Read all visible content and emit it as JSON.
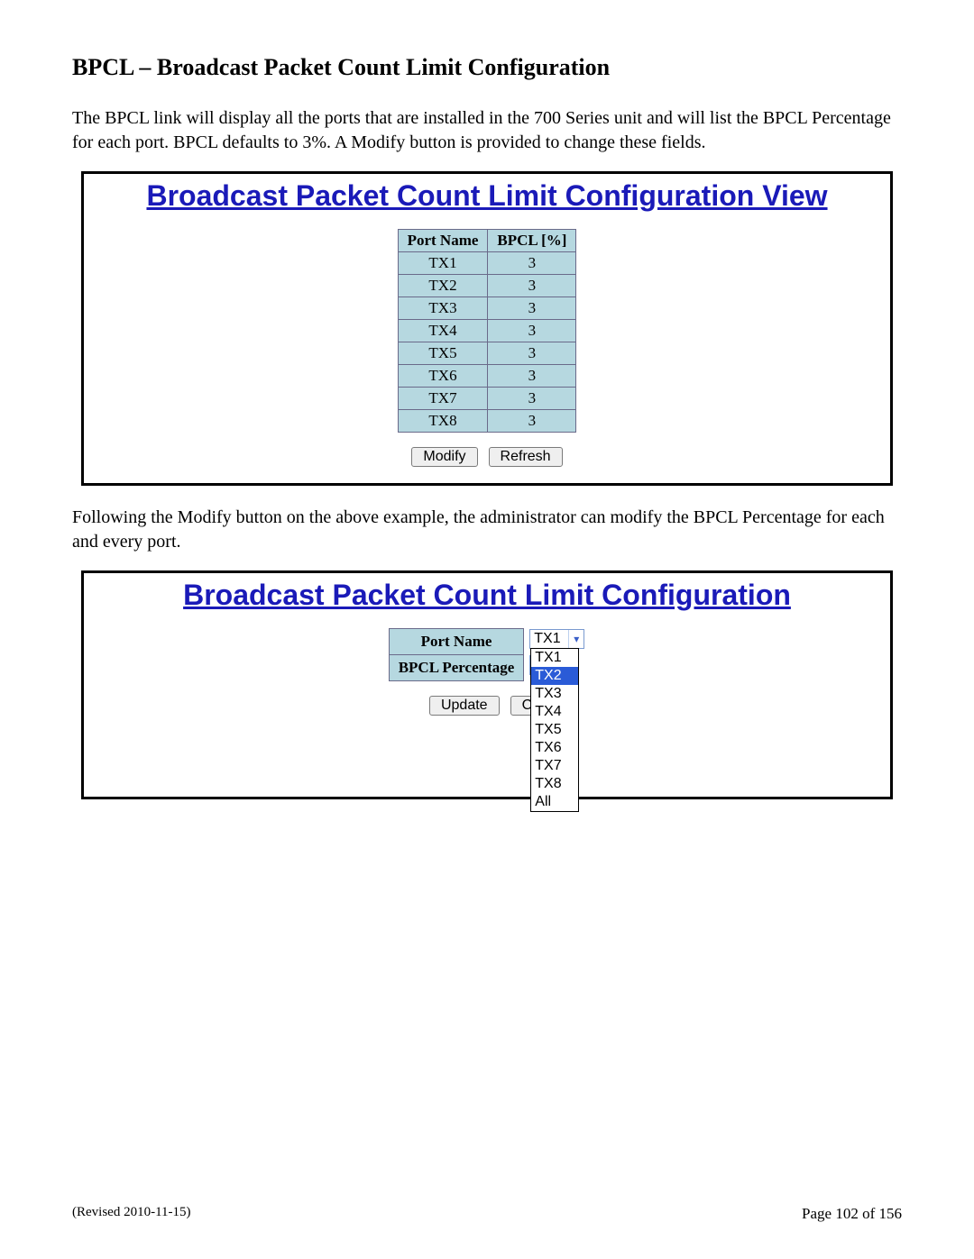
{
  "heading": "BPCL – Broadcast Packet Count Limit Configuration",
  "para1": "The BPCL link will display all the ports that are installed in the 700 Series unit and will list the BPCL Percentage for each port.  BPCL defaults to 3%. A Modify button is provided to change these fields.",
  "para2": "Following the Modify button on the above example, the administrator can modify the BPCL Percentage for each and every port.",
  "panel1": {
    "title": "Broadcast Packet Count Limit Configuration View",
    "col1": "Port Name",
    "col2": "BPCL [%]",
    "rows": [
      {
        "port": "TX1",
        "pct": "3"
      },
      {
        "port": "TX2",
        "pct": "3"
      },
      {
        "port": "TX3",
        "pct": "3"
      },
      {
        "port": "TX4",
        "pct": "3"
      },
      {
        "port": "TX5",
        "pct": "3"
      },
      {
        "port": "TX6",
        "pct": "3"
      },
      {
        "port": "TX7",
        "pct": "3"
      },
      {
        "port": "TX8",
        "pct": "3"
      }
    ],
    "modify": "Modify",
    "refresh": "Refresh"
  },
  "panel2": {
    "title": "Broadcast Packet Count Limit Configuration",
    "portLabel": "Port Name",
    "pctLabel": "BPCL Percentage",
    "selected": "TX1",
    "highlight": "TX2",
    "options": [
      "TX1",
      "TX2",
      "TX3",
      "TX4",
      "TX5",
      "TX6",
      "TX7",
      "TX8",
      "All"
    ],
    "update": "Update",
    "cancelPartial": "Ca"
  },
  "footer": {
    "revised": "(Revised 2010-11-15)",
    "page": "Page 102 of 156"
  }
}
